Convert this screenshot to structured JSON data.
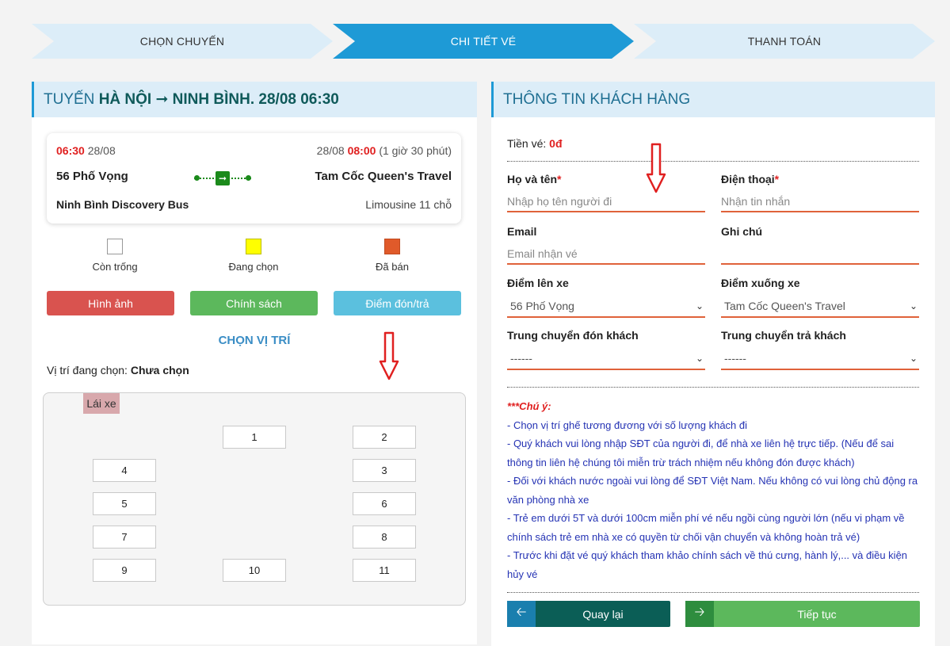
{
  "steps": [
    {
      "label": "CHỌN CHUYẾN"
    },
    {
      "label": "CHI TIẾT VÉ"
    },
    {
      "label": "THANH TOÁN"
    }
  ],
  "route": {
    "prefix": "TUYẾN",
    "name": "HÀ NỘI ➞ NINH BÌNH",
    "datetime": ". 28/08 06:30"
  },
  "trip": {
    "depart_time": "06:30",
    "depart_date": "28/08",
    "arrive_date": "28/08",
    "arrive_time": "08:00",
    "duration": "(1 giờ 30 phút)",
    "from": "56 Phố Vọng",
    "to": "Tam Cốc Queen's Travel",
    "operator": "Ninh Bình Discovery Bus",
    "vehicle": "Limousine 11 chỗ"
  },
  "legend": [
    {
      "label": "Còn trống",
      "color": "#ffffff"
    },
    {
      "label": "Đang chọn",
      "color": "#ffff00"
    },
    {
      "label": "Đã bán",
      "color": "#e05a2a"
    }
  ],
  "buttons": {
    "images": "Hình ảnh",
    "policy": "Chính sách",
    "pickup": "Điểm đón/trả"
  },
  "choose_title": "CHỌN VỊ TRÍ",
  "selected": {
    "label": "Vị trí đang chọn: ",
    "value": "Chưa chọn"
  },
  "seatmap": {
    "driver": "Lái xe",
    "seats": [
      "1",
      "2",
      "4",
      "3",
      "5",
      "6",
      "7",
      "8",
      "9",
      "10",
      "11"
    ]
  },
  "customer": {
    "title": "THÔNG TIN KHÁCH HÀNG",
    "price_label": "Tiền vé: ",
    "price_value": "0đ",
    "name_label": "Họ và tên",
    "name_placeholder": "Nhập họ tên người đi",
    "phone_label": "Điện thoại",
    "phone_placeholder": "Nhận tin nhắn",
    "email_label": "Email",
    "email_placeholder": "Email nhận vé",
    "note_label": "Ghi chú",
    "note_placeholder": "",
    "pickup_label": "Điểm lên xe",
    "pickup_value": "56 Phố Vọng",
    "dropoff_label": "Điểm xuống xe",
    "dropoff_value": "Tam Cốc Queen's Travel",
    "transfer_pick_label": "Trung chuyển đón khách",
    "transfer_pick_value": "------",
    "transfer_drop_label": "Trung chuyển trả khách",
    "transfer_drop_value": "------",
    "required_mark": "*"
  },
  "notes": {
    "title": "***Chú ý:",
    "lines": [
      "- Chọn vị trí ghế tương đương với số lượng khách đi",
      "- Quý khách vui lòng nhập SĐT của người đi, để nhà xe liên hệ trực tiếp. (Nếu để sai thông tin liên hệ chúng tôi miễn trừ trách nhiệm nếu không đón được khách)",
      "- Đối với khách nước ngoài vui lòng để SĐT Việt Nam. Nếu không có vui lòng chủ động ra văn phòng nhà xe",
      "- Trẻ em dưới 5T và dưới 100cm miễn phí vé nếu ngồi cùng người lớn (nếu vi phạm về chính sách trẻ em nhà xe có quyền từ chối vận chuyển và không hoàn trả vé)",
      "- Trước khi đặt vé quý khách tham khảo chính sách về thú cưng, hành lý,... và điều kiện hủy vé"
    ]
  },
  "actions": {
    "back": "Quay lại",
    "next": "Tiếp tục"
  },
  "colors": {
    "accent": "#1e9ad6",
    "danger": "#d9534f",
    "success": "#5cb85c",
    "info": "#5bc0de",
    "input_underline": "#e0623a"
  }
}
